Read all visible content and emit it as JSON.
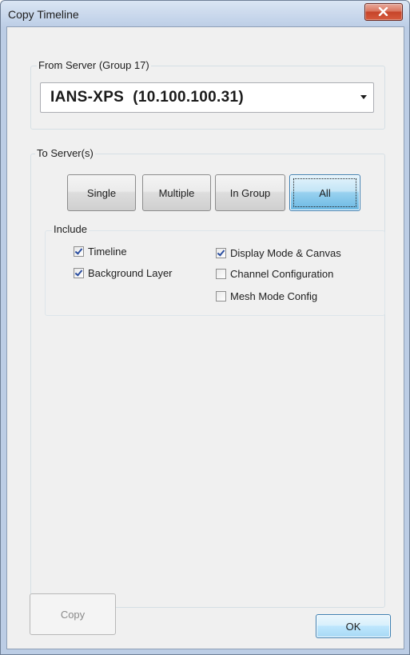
{
  "window": {
    "title": "Copy Timeline"
  },
  "from_server": {
    "group_label": "From Server  (Group 17)",
    "selected": "IANS-XPS  (10.100.100.31)"
  },
  "to_servers": {
    "group_label": "To Server(s)",
    "modes": [
      {
        "label": "Single",
        "selected": false
      },
      {
        "label": "Multiple",
        "selected": false
      },
      {
        "label": "In Group",
        "selected": false
      },
      {
        "label": "All",
        "selected": true
      }
    ],
    "include": {
      "label": "Include",
      "left": [
        {
          "label": "Timeline",
          "checked": true
        },
        {
          "label": "Background Layer",
          "checked": true
        }
      ],
      "right": [
        {
          "label": "Display Mode & Canvas",
          "checked": true
        },
        {
          "label": "Channel Configuration",
          "checked": false
        },
        {
          "label": "Mesh Mode Config",
          "checked": false
        }
      ]
    }
  },
  "buttons": {
    "copy": "Copy",
    "ok": "OK"
  },
  "colors": {
    "title_gradient": "#c4d4ea",
    "close_red": "#c6442a",
    "selected_blue": "#98d1ef",
    "client_bg": "#f0f0f0"
  }
}
